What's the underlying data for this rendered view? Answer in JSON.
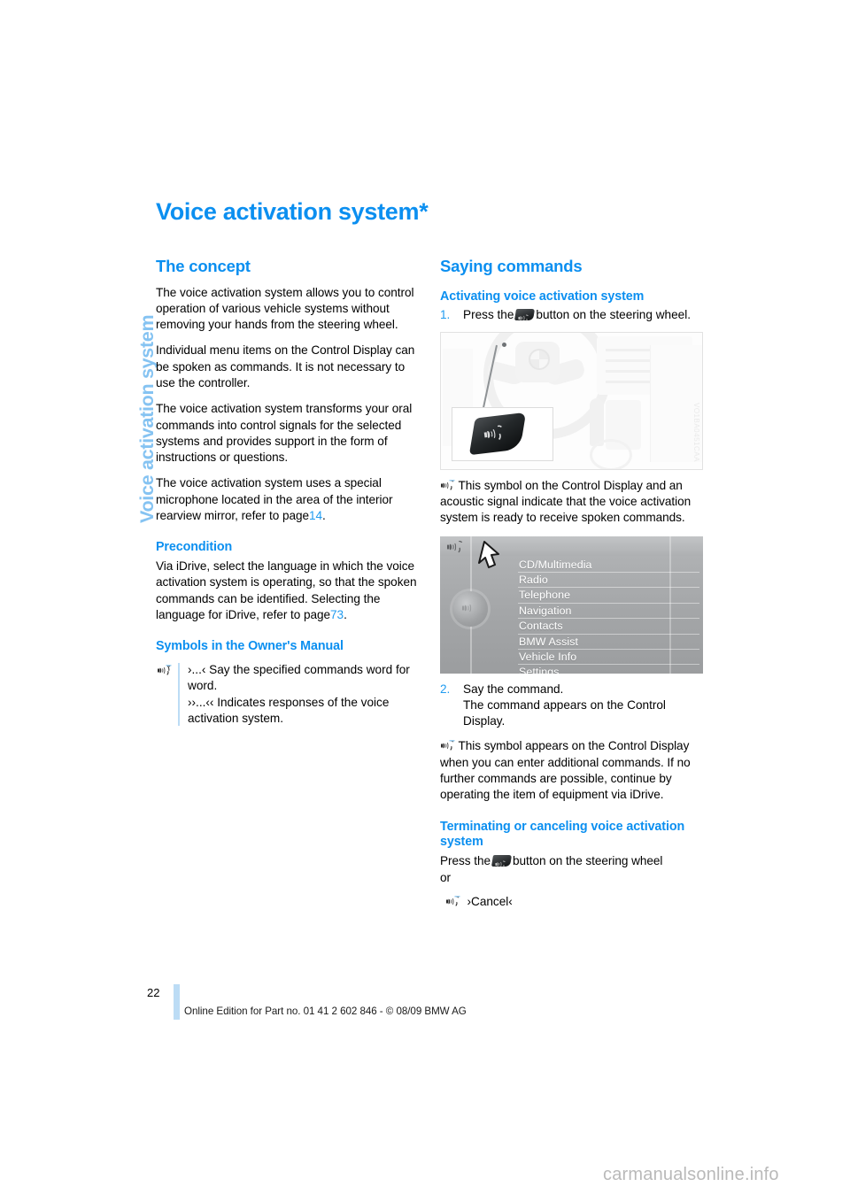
{
  "sidebar": {
    "running_head": "Voice activation system"
  },
  "chapter": {
    "title": "Voice activation system",
    "title_marker": "*"
  },
  "left_column": {
    "concept": {
      "heading": "The concept",
      "paragraphs": [
        "The voice activation system allows you to control operation of various vehicle systems without removing your hands from the steering wheel.",
        "Individual menu items on the Control Display can be spoken as commands. It is not necessary to use the controller.",
        "The voice activation system transforms your oral commands into control signals for the selected systems and provides support in the form of instructions or questions."
      ],
      "mic_paragraph_before": "The voice activation system uses a special microphone located in the area of the interior rearview mirror, refer to page",
      "mic_page_ref": "14",
      "mic_paragraph_after": "."
    },
    "precondition": {
      "heading": "Precondition",
      "text_before": "Via iDrive, select the language in which the voice activation system is operating, so that the spoken commands can be identified. Selecting the language for iDrive, refer to page",
      "page_ref": "73",
      "text_after": "."
    },
    "symbols": {
      "heading": "Symbols in the Owner's Manual",
      "icon": "voice-activation-icon",
      "line1": "›...‹ Say the specified commands word for word.",
      "line2": "››...‹‹ Indicates responses of the voice activation system."
    }
  },
  "right_column": {
    "saying_commands": {
      "heading": "Saying commands"
    },
    "activating": {
      "heading": "Activating voice activation system",
      "step1_number": "1.",
      "step1_before": "Press the",
      "step1_icon": "steering-wheel-voice-button-icon",
      "step1_after": "button on the steering wheel.",
      "figure_wheel": {
        "name": "steering-wheel-figure",
        "watermark": "VO1BA0451CAA"
      },
      "symbol_note_icon": "voice-activation-icon",
      "symbol_note": "This symbol on the Control Display and an acoustic signal indicate that the voice activation system is ready to receive spoken commands."
    },
    "idrive_figure": {
      "name": "control-display-main-menu-figure",
      "menu_items": [
        "CD/Multimedia",
        "Radio",
        "Telephone",
        "Navigation",
        "Contacts",
        "BMW Assist",
        "Vehicle Info",
        "Settings"
      ]
    },
    "step2": {
      "number": "2.",
      "line1": "Say the command.",
      "line2": "The command appears on the Control Display."
    },
    "additional_note": {
      "icon": "voice-activation-icon",
      "text": "This symbol appears on the Control Display when you can enter additional commands. If no further commands are possible, continue by operating the item of equipment via iDrive."
    },
    "terminating": {
      "heading": "Terminating or canceling voice activation system",
      "press_before": "Press the",
      "press_icon": "steering-wheel-voice-button-icon",
      "press_after": "button on the steering wheel",
      "or": "or",
      "cancel_icon": "voice-activation-icon",
      "cancel_command": "›Cancel‹"
    }
  },
  "footer": {
    "page_number": "22",
    "edition_line": "Online Edition for Part no. 01 41 2 602 846 - © 08/09 BMW AG",
    "site_watermark": "carmanualsonline.info"
  },
  "colors": {
    "accent_blue": "#0b8ff0",
    "link_blue": "#1f9bf0",
    "running_head_blue": "#85c3f2",
    "rule_blue": "#bcdcf5"
  }
}
